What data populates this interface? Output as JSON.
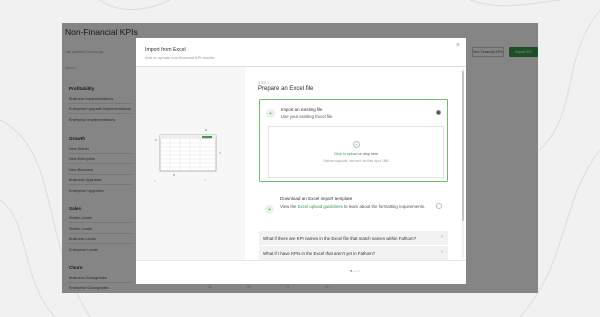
{
  "app": {
    "title": "Non-Financial KPIs",
    "subtitle": "Last updated 5 months ago",
    "header_buttons": [
      "Non-Financial KPIs",
      "Import KPI"
    ],
    "search_placeholder": "Search...",
    "footer_numbers": [
      "31",
      "23",
      "21",
      "24"
    ]
  },
  "sidebar": {
    "groups": [
      {
        "heading": "Profitability",
        "items": [
          "Business Implementations",
          "Enterprise Upgrade Implementations",
          "Enterprise Implementations"
        ]
      },
      {
        "heading": "Growth",
        "items": [
          "New Starter",
          "New Enterprise",
          "New Business",
          "Business Upgrades",
          "Enterprise Upgrades"
        ]
      },
      {
        "heading": "Sales",
        "items": [
          "Starter Leads",
          "Starter Leads",
          "Business Leads",
          "Enterprise Leads"
        ]
      },
      {
        "heading": "Churn",
        "items": [
          "Business Downgrades",
          "Enterprise Downgrades"
        ]
      }
    ]
  },
  "modal": {
    "title": "Import from Excel",
    "subtitle": "Add or update non-financial KPI results",
    "close_icon": "close-icon",
    "step_label": "STEP 1",
    "step_title": "Prepare an Excel file",
    "option1": {
      "title": "Import an existing file",
      "description": "Use your existing Excel file",
      "selected": true,
      "upload_link": "Click to upload",
      "upload_rest": "or drop here",
      "upload_note": "Fathom supports .xlsx and .xls files up to 1MB"
    },
    "option2": {
      "title": "Download an Excel import template",
      "desc_before": "View the",
      "desc_link": "Excel upload guidelines",
      "desc_after": "to learn about the formatting requirements.",
      "selected": false
    },
    "faqs": [
      "What if there are KPI names in the Excel file that match names within Fathom?",
      "What if I have KPIs in the Excel that aren't yet in Fathom?"
    ],
    "pager": "●—○"
  },
  "colors": {
    "accent": "#3a9a4e",
    "overlay": "rgba(0,0,0,0.48)"
  }
}
